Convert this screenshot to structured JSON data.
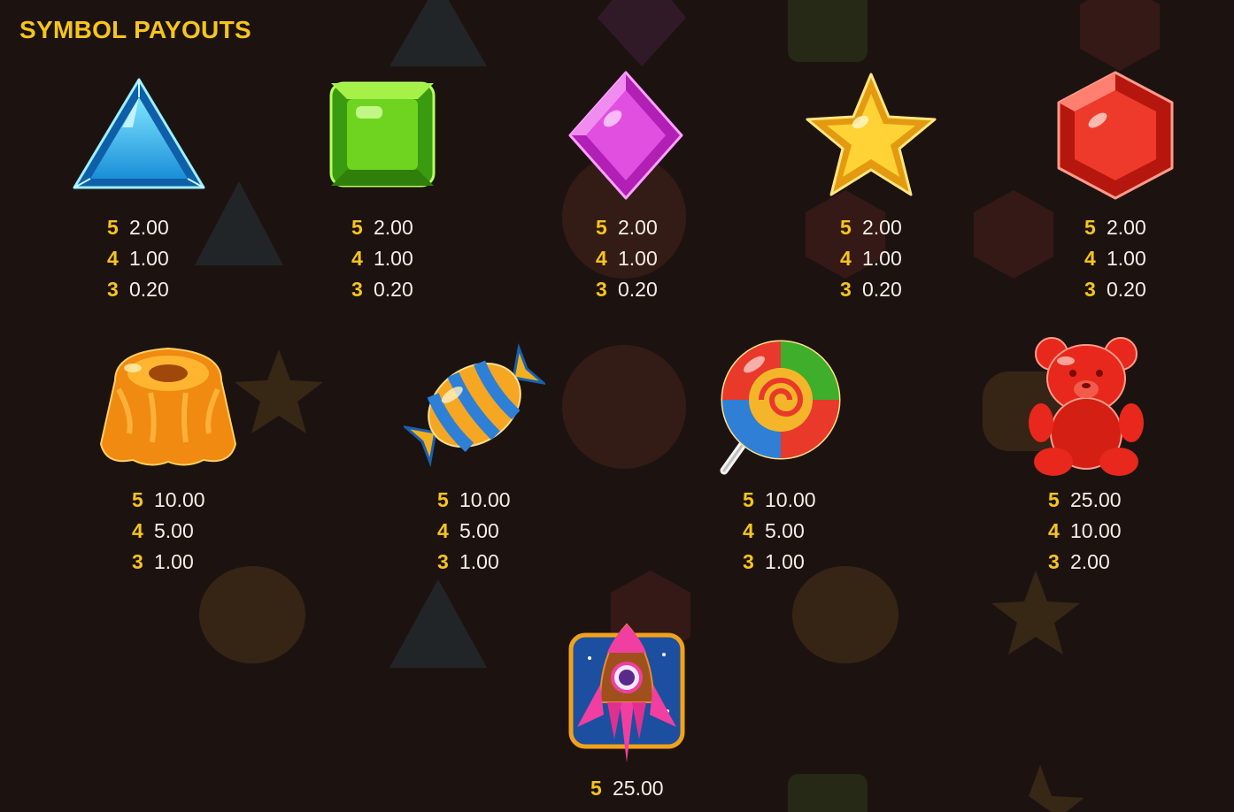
{
  "title": "SYMBOL PAYOUTS",
  "colors": {
    "background": "#1c1311",
    "title": "#f7c51a",
    "count": "#f7c51a",
    "value": "#f4eee6"
  },
  "symbols": [
    {
      "name": "blue-triangle-gem",
      "icon": "triangle-gem-icon",
      "payouts": [
        {
          "count": "5",
          "value": "2.00"
        },
        {
          "count": "4",
          "value": "1.00"
        },
        {
          "count": "3",
          "value": "0.20"
        }
      ]
    },
    {
      "name": "green-square-gem",
      "icon": "square-gem-icon",
      "payouts": [
        {
          "count": "5",
          "value": "2.00"
        },
        {
          "count": "4",
          "value": "1.00"
        },
        {
          "count": "3",
          "value": "0.20"
        }
      ]
    },
    {
      "name": "pink-diamond-gem",
      "icon": "diamond-gem-icon",
      "payouts": [
        {
          "count": "5",
          "value": "2.00"
        },
        {
          "count": "4",
          "value": "1.00"
        },
        {
          "count": "3",
          "value": "0.20"
        }
      ]
    },
    {
      "name": "yellow-star-gem",
      "icon": "star-gem-icon",
      "payouts": [
        {
          "count": "5",
          "value": "2.00"
        },
        {
          "count": "4",
          "value": "1.00"
        },
        {
          "count": "3",
          "value": "0.20"
        }
      ]
    },
    {
      "name": "red-hexagon-gem",
      "icon": "hexagon-gem-icon",
      "payouts": [
        {
          "count": "5",
          "value": "2.00"
        },
        {
          "count": "4",
          "value": "1.00"
        },
        {
          "count": "3",
          "value": "0.20"
        }
      ]
    },
    {
      "name": "orange-jelly",
      "icon": "jelly-pudding-icon",
      "payouts": [
        {
          "count": "5",
          "value": "10.00"
        },
        {
          "count": "4",
          "value": "5.00"
        },
        {
          "count": "3",
          "value": "1.00"
        }
      ]
    },
    {
      "name": "striped-candy",
      "icon": "wrapped-candy-icon",
      "payouts": [
        {
          "count": "5",
          "value": "10.00"
        },
        {
          "count": "4",
          "value": "5.00"
        },
        {
          "count": "3",
          "value": "1.00"
        }
      ]
    },
    {
      "name": "lollipop",
      "icon": "lollipop-icon",
      "payouts": [
        {
          "count": "5",
          "value": "10.00"
        },
        {
          "count": "4",
          "value": "5.00"
        },
        {
          "count": "3",
          "value": "1.00"
        }
      ]
    },
    {
      "name": "gummy-bear",
      "icon": "gummy-bear-icon",
      "payouts": [
        {
          "count": "5",
          "value": "25.00"
        },
        {
          "count": "4",
          "value": "10.00"
        },
        {
          "count": "3",
          "value": "2.00"
        }
      ]
    },
    {
      "name": "rocket-scatter",
      "icon": "rocket-icon",
      "payouts": [
        {
          "count": "5",
          "value": "25.00"
        }
      ]
    }
  ]
}
